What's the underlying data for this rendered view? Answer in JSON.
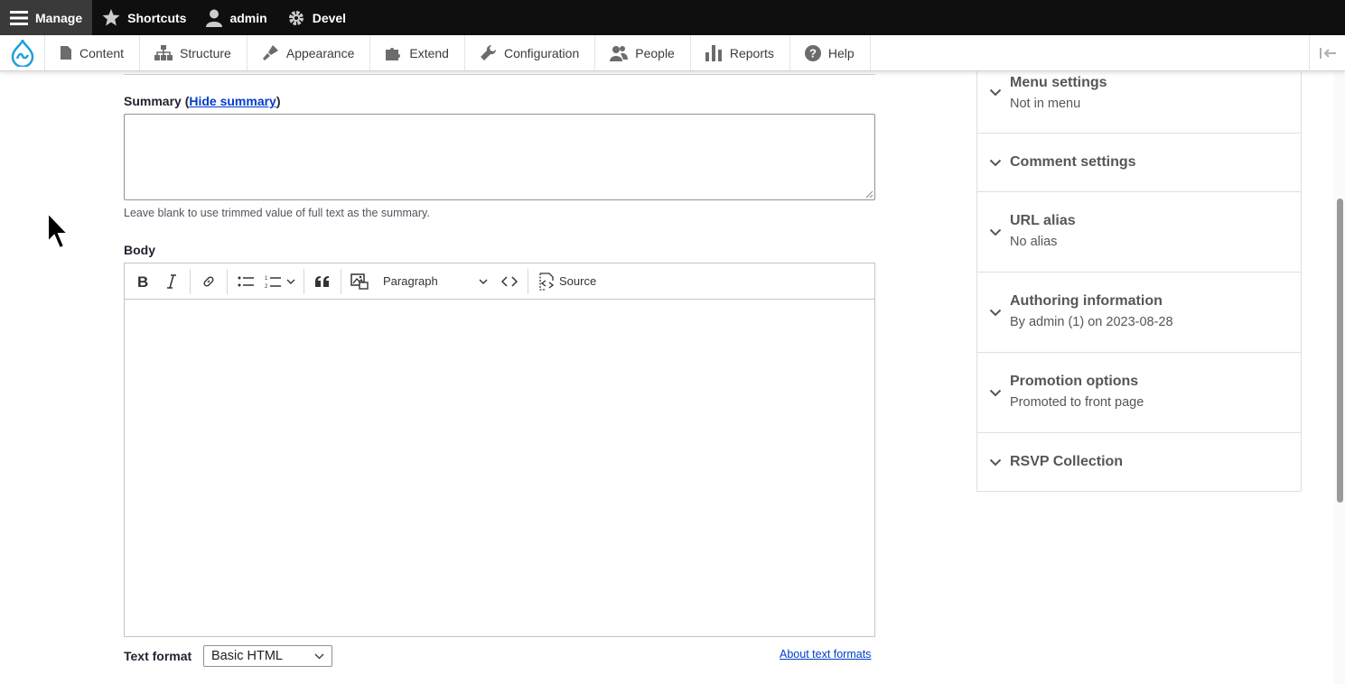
{
  "toolbar": {
    "manage": "Manage",
    "shortcuts": "Shortcuts",
    "user": "admin",
    "devel": "Devel"
  },
  "tray": {
    "items": [
      {
        "label": "Content",
        "icon": "page-icon"
      },
      {
        "label": "Structure",
        "icon": "sitemap-icon"
      },
      {
        "label": "Appearance",
        "icon": "paintbrush-icon"
      },
      {
        "label": "Extend",
        "icon": "puzzle-icon"
      },
      {
        "label": "Configuration",
        "icon": "wrench-icon"
      },
      {
        "label": "People",
        "icon": "people-icon"
      },
      {
        "label": "Reports",
        "icon": "bar-chart-icon"
      },
      {
        "label": "Help",
        "icon": "help-icon"
      }
    ]
  },
  "summary": {
    "label_prefix": "Summary (",
    "toggle_link": "Hide summary",
    "label_suffix": ")",
    "value": "",
    "help": "Leave blank to use trimmed value of full text as the summary."
  },
  "body": {
    "label": "Body",
    "heading_select": "Paragraph",
    "source_label": "Source"
  },
  "text_format": {
    "label": "Text format",
    "selected": "Basic HTML",
    "about_link": "About text formats"
  },
  "sidebar": {
    "sections": [
      {
        "title": "Menu settings",
        "summary": "Not in menu"
      },
      {
        "title": "Comment settings",
        "summary": ""
      },
      {
        "title": "URL alias",
        "summary": "No alias"
      },
      {
        "title": "Authoring information",
        "summary": "By admin (1) on 2023-08-28"
      },
      {
        "title": "Promotion options",
        "summary": "Promoted to front page"
      },
      {
        "title": "RSVP Collection",
        "summary": ""
      }
    ]
  }
}
